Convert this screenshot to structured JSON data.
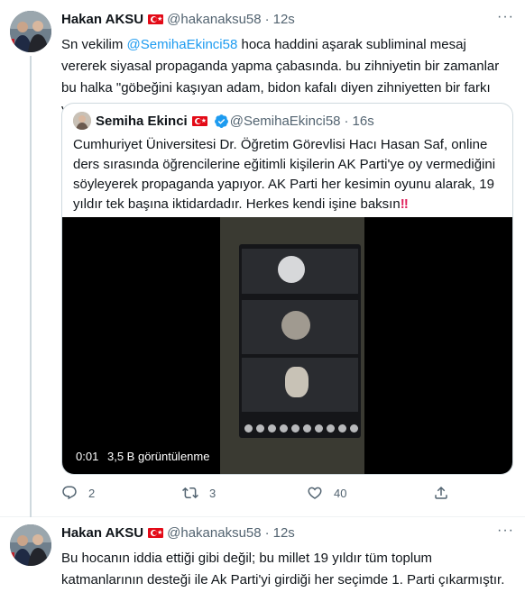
{
  "tweet1": {
    "author_name": "Hakan AKSU",
    "author_handle": "@hakanaksu58",
    "separator": "·",
    "time": "12s",
    "text_prefix": "Sn vekilim ",
    "mention": "@SemihaEkinci58",
    "text_suffix": " hoca haddini aşarak subliminal mesaj vererek siyasal propaganda yapma çabasında. bu zihniyetin bir zamanlar bu halka \"göbeğini kaşıyan adam, bidon kafalı diyen zihniyetten bir farkı yoktur.",
    "quote": {
      "author_name": "Semiha Ekinci",
      "author_handle": "@SemihaEkinci58",
      "separator": "·",
      "time": "16s",
      "text": "Cumhuriyet Üniversitesi Dr. Öğretim Görevlisi Hacı Hasan Saf, online ders sırasında öğrencilerine eğitimli kişilerin AK Parti'ye oy vermediğini söyleyerek propaganda yapıyor. AK Parti her kesimin oyunu alarak, 19 yıldır tek başına iktidardadır. Herkes kendi işine baksın",
      "emoji": "‼",
      "video": {
        "elapsed": "0:01",
        "views": "3,5 B görüntülenme"
      }
    },
    "actions": {
      "replies": "2",
      "retweets": "3",
      "likes": "40"
    }
  },
  "tweet2": {
    "author_name": "Hakan AKSU",
    "author_handle": "@hakanaksu58",
    "separator": "·",
    "time": "12s",
    "text": "Bu hocanın iddia ettiği gibi değil; bu millet 19 yıldır tüm toplum katmanlarının desteği ile Ak Parti'yi girdiği her seçimde 1. Parti çıkarmıştır."
  },
  "more_label": "···",
  "icons": {
    "reply": "reply-icon",
    "retweet": "retweet-icon",
    "like": "heart-icon",
    "share": "share-icon",
    "verified": "verified-badge-icon",
    "flag": "turkey-flag-icon"
  },
  "colors": {
    "link": "#1d9bf0",
    "text": "#0f1419",
    "muted": "#536471",
    "border": "#cfd9de"
  }
}
